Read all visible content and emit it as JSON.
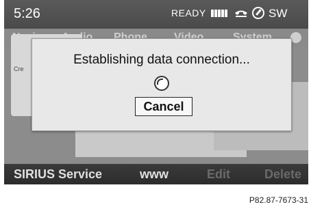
{
  "status": {
    "time": "5:26",
    "ready_label": "READY",
    "direction": "SW"
  },
  "menu": {
    "items": [
      "Navi",
      "Audio",
      "Phone",
      "Video",
      "System"
    ]
  },
  "background": {
    "card_label": "Cre"
  },
  "dialog": {
    "message": "Establishing data connection...",
    "cancel_label": "Cancel"
  },
  "bottom_bar": {
    "items": [
      "SIRIUS Service",
      "www",
      "Edit",
      "Delete"
    ]
  },
  "footer_code": "P82.87-7673-31"
}
